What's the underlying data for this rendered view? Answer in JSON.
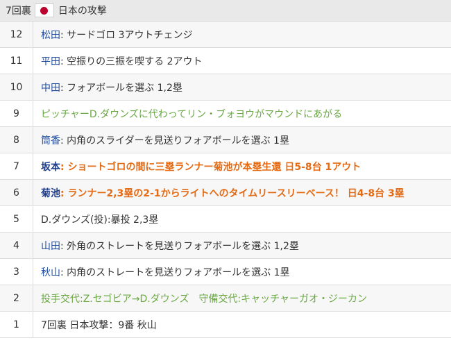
{
  "header": {
    "inning": "7回裏",
    "flag_icon": "japan-flag-icon",
    "title": "日本の攻撃"
  },
  "colors": {
    "player": "#1f4ca0",
    "change": "#6aa843",
    "score": "#e46a14"
  },
  "plays": [
    {
      "num": "12",
      "player": "松田",
      "sep": ": ",
      "text": "サードゴロ 3アウトチェンジ"
    },
    {
      "num": "11",
      "player": "平田",
      "sep": ": ",
      "text": "空振りの三振を喫する 2アウト"
    },
    {
      "num": "10",
      "player": "中田",
      "sep": ": ",
      "text": "フォアボールを選ぶ 1,2塁"
    },
    {
      "num": "9",
      "text": "ピッチャーD.ダウンズに代わってリン・ブォヨウがマウンドにあがる"
    },
    {
      "num": "8",
      "player": "筒香",
      "sep": ": ",
      "text": "内角のスライダーを見送りフォアボールを選ぶ 1塁"
    },
    {
      "num": "7",
      "player": "坂本",
      "sep": ": ",
      "text": "ショートゴロの間に三塁ランナー菊池が本塁生還 日5-8台 1アウト"
    },
    {
      "num": "6",
      "player": "菊池",
      "sep": ": ",
      "text": "ランナー2,3塁の2-1からライトへのタイムリースリーベース！ 日4-8台 3塁"
    },
    {
      "num": "5",
      "text": "D.ダウンズ(投):暴投 2,3塁"
    },
    {
      "num": "4",
      "player": "山田",
      "sep": ": ",
      "text": "外角のストレートを見送りフォアボールを選ぶ 1,2塁"
    },
    {
      "num": "3",
      "player": "秋山",
      "sep": ": ",
      "text": "内角のストレートを見送りフォアボールを選ぶ 1塁"
    },
    {
      "num": "2",
      "text": "投手交代:Z.セゴビア→D.ダウンズ　守備交代:キャッチャーガオ・ジーカン"
    },
    {
      "num": "1",
      "text": "7回裏 日本攻撃：9番 秋山"
    }
  ]
}
